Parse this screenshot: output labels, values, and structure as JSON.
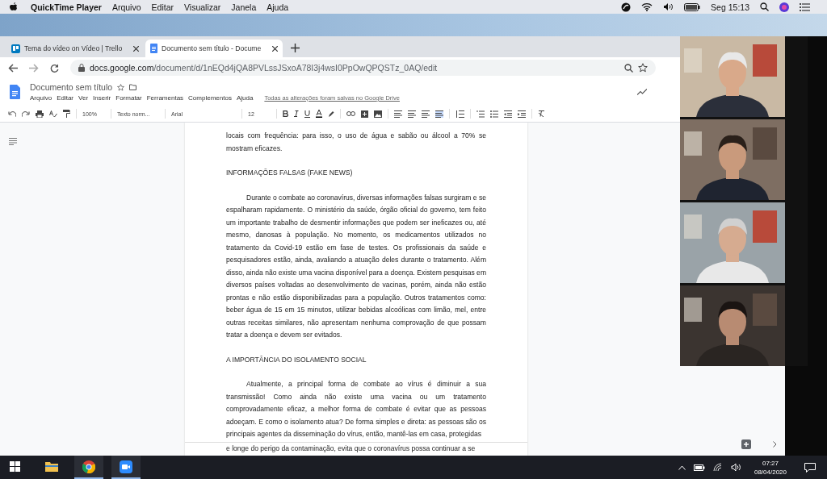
{
  "mac_menubar": {
    "app": "QuickTime Player",
    "menus": [
      "Arquivo",
      "Editar",
      "Visualizar",
      "Janela",
      "Ajuda"
    ],
    "clock": "Seg 15:13"
  },
  "browser": {
    "tabs": [
      {
        "title": "Tema do vídeo on Vídeo | Trello",
        "kind": "trello",
        "selected": false
      },
      {
        "title": "Documento sem título - Docume",
        "kind": "docs",
        "selected": true
      }
    ],
    "url_host": "docs.google.com",
    "url_path": "/document/d/1nEQd4jQA8PVLssJSxoA78I3j4wsI0PpOwQPQSTz_0AQ/edit"
  },
  "docs": {
    "title": "Documento sem título",
    "menus": [
      "Arquivo",
      "Editar",
      "Ver",
      "Inserir",
      "Formatar",
      "Ferramentas",
      "Complementos",
      "Ajuda"
    ],
    "save_status": "Todas as alterações foram salvas no Google Drive",
    "toolbar": {
      "zoom": "100%",
      "style": "Texto norm...",
      "font": "Arial",
      "size": "12"
    }
  },
  "document": [
    {
      "kind": "paragraph",
      "indent": false,
      "text": "locais com frequência: para isso, o uso de água e sabão ou álcool a 70% se mostram eficazes."
    },
    {
      "kind": "heading",
      "text": "INFORMAÇÕES FALSAS (FAKE NEWS)"
    },
    {
      "kind": "paragraph",
      "indent": true,
      "text": "Durante o combate ao coronavírus, diversas informações falsas surgiram e se espalharam rapidamente. O ministério da saúde, órgão oficial do governo, tem feito um importante trabalho de desmentir informações que podem ser ineficazes ou, até mesmo, danosas à população. No momento, os medicamentos utilizados no tratamento da Covid-19 estão em fase de testes. Os profissionais da saúde e pesquisadores estão, ainda, avaliando a atuação deles durante o tratamento. Além disso, ainda não existe uma vacina disponível para a doença. Existem pesquisas em diversos países voltadas ao desenvolvimento de vacinas, porém, ainda não estão prontas e não estão disponibilizadas para a população. Outros tratamentos como: beber água de 15 em 15 minutos, utilizar bebidas alcoólicas com limão, mel, entre outras receitas similares, não apresentam nenhuma comprovação de que possam tratar a doença e devem ser evitados."
    },
    {
      "kind": "heading",
      "text": "A IMPORTÂNCIA DO ISOLAMENTO SOCIAL"
    },
    {
      "kind": "paragraph",
      "indent": true,
      "text": "Atualmente, a principal forma de combate ao vírus é diminuir a sua transmissão! Como ainda não existe uma vacina ou um tratamento comprovadamente eficaz, a melhor forma de combate é evitar que as pessoas adoeçam. E como o isolamento atua? De forma simples e direta: as pessoas são os principais agentes da disseminação do vírus, então, mantê-las em casa, protegidas"
    },
    {
      "kind": "paragraph",
      "indent": false,
      "after_break": true,
      "text": "e longe do perigo da contaminação, evita que o coronavírus possa continuar a se"
    }
  ],
  "taskbar": {
    "apps": [
      {
        "kind": "start",
        "running": false
      },
      {
        "kind": "explorer",
        "running": false
      },
      {
        "kind": "chrome",
        "running": true
      },
      {
        "kind": "zoom",
        "running": true
      }
    ],
    "time": "07:27",
    "date": "08/04/2020"
  }
}
